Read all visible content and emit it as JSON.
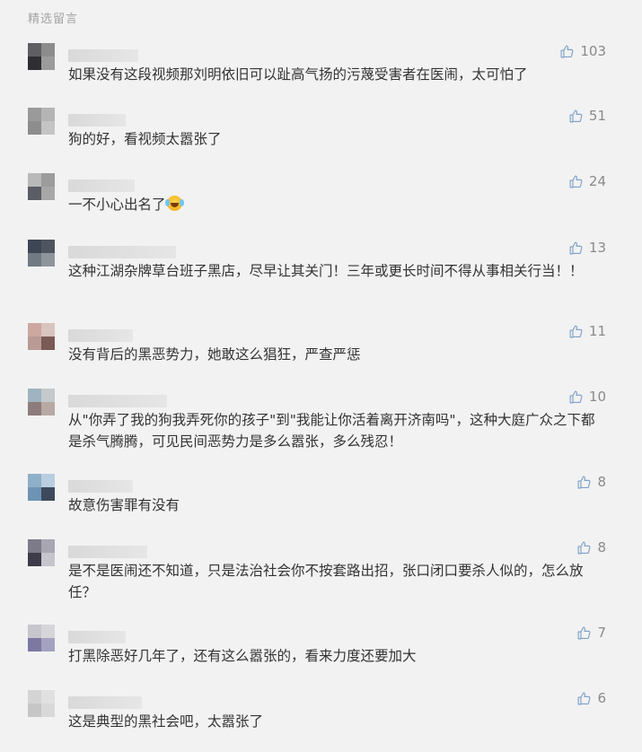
{
  "section_title": "精选留言",
  "comments": [
    {
      "likes": "103",
      "text": "如果没有这段视频那刘明依旧可以趾高气扬的污蔑受害者在医闹，太可怕了",
      "avatar_colors": [
        "#5f5f63",
        "#8c8c8c",
        "#2e2e33",
        "#9b9b9b"
      ]
    },
    {
      "likes": "51",
      "text": "狗的好，看视频太嚣张了",
      "avatar_colors": [
        "#9a9a9a",
        "#b4b4b4",
        "#8d8d8d",
        "#c4c4c4"
      ]
    },
    {
      "likes": "24",
      "text": "一不小心出名了",
      "emoji": "laughing-tears-emoji",
      "avatar_colors": [
        "#b9b9b9",
        "#9c9c9c",
        "#5c5c66",
        "#a7a7a7"
      ]
    },
    {
      "likes": "13",
      "text": "这种江湖杂牌草台班子黑店，尽早让其关门！三年或更长时间不得从事相关行当！！",
      "avatar_colors": [
        "#3d4654",
        "#4d5660",
        "#707a82",
        "#8e949c"
      ]
    },
    {
      "likes": "11",
      "text": "没有背后的黑恶势力，她敢这么猖狂，严查严惩",
      "avatar_colors": [
        "#cda8a0",
        "#d9c4bf",
        "#b99a94",
        "#7b5a55"
      ]
    },
    {
      "likes": "10",
      "text": "从\"你弄了我的狗我弄死你的孩子\"到\"我能让你活着离开济南吗\"，这种大庭广众之下都是杀气腾腾，可见民间恶势力是多么嚣张，多么残忍！",
      "avatar_colors": [
        "#9fb4c0",
        "#c5c9cc",
        "#8c7c7c",
        "#b8a9a4"
      ]
    },
    {
      "likes": "8",
      "text": "故意伤害罪有没有",
      "avatar_colors": [
        "#8fb0c9",
        "#b9cede",
        "#6e93b4",
        "#3c4a5c"
      ]
    },
    {
      "likes": "8",
      "text": "是不是医闹还不知道，只是法治社会你不按套路出招，张口闭口要杀人似的，怎么放任？",
      "avatar_colors": [
        "#7d7a8a",
        "#a8a6b2",
        "#3e3c48",
        "#c6c4cc"
      ]
    },
    {
      "likes": "7",
      "text": "打黑除恶好几年了，还有这么嚣张的，看来力度还要加大",
      "avatar_colors": [
        "#c6c6cc",
        "#d5d5da",
        "#7c78a2",
        "#a4a2c0"
      ]
    },
    {
      "likes": "6",
      "text": "这是典型的黑社会吧，太嚣张了",
      "avatar_colors": [
        "#d4d4d4",
        "#e0e0e0",
        "#c6c6c6",
        "#d9d9d9"
      ]
    }
  ]
}
